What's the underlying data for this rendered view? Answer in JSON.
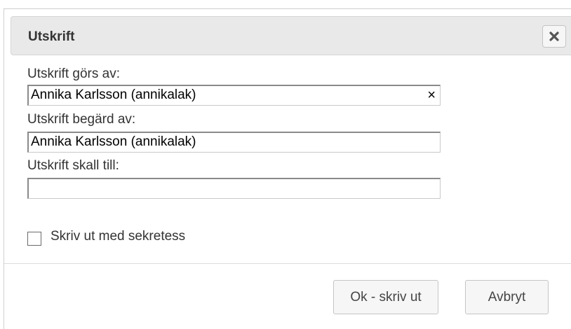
{
  "dialog": {
    "title": "Utskrift",
    "close_icon": "close-icon"
  },
  "form": {
    "printed_by_label": "Utskrift görs av:",
    "printed_by_value": "Annika Karlsson (annikalak)",
    "requested_by_label": "Utskrift begärd av:",
    "requested_by_value": "Annika Karlsson (annikalak)",
    "recipient_label": "Utskrift skall till:",
    "recipient_value": "",
    "clear_symbol": "×",
    "secrecy_checkbox_label": "Skriv ut med sekretess",
    "secrecy_checked": false
  },
  "buttons": {
    "ok_label": "Ok - skriv ut",
    "cancel_label": "Avbryt"
  }
}
